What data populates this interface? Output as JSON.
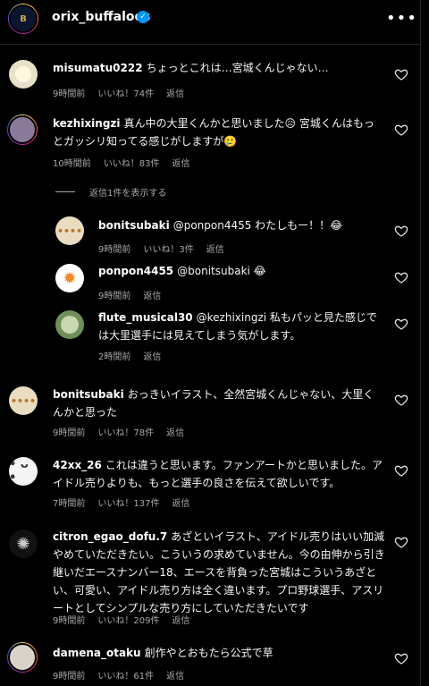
{
  "header": {
    "username": "orix_buffaloes",
    "more_label": "•••"
  },
  "labels": {
    "like": "いいね！",
    "reply": "返信",
    "show_replies": "返信1件を表示する"
  },
  "comments": [
    {
      "user": "misumatu0222",
      "text": "ちょっとこれは…宮城くんじゃない…",
      "time": "9時間前",
      "likes": "いいね！74件",
      "reply": "返信"
    },
    {
      "user": "kezhixingzi",
      "text": "真ん中の大里くんかと思いました😥 宮城くんはもっとガッシリ知ってる感じがしますが🥲",
      "time": "10時間前",
      "likes": "いいね！83件",
      "reply": "返信"
    },
    {
      "user": "bonitsubaki",
      "text": "@ponpon4455 わたしもー！！😂",
      "time": "9時間前",
      "likes": "いいね！3件",
      "reply": "返信"
    },
    {
      "user": "ponpon4455",
      "text": "@bonitsubaki 😂",
      "time": "9時間前",
      "likes": "",
      "reply": "返信"
    },
    {
      "user": "flute_musical30",
      "text": "@kezhixingzi 私もパッと見た感じでは大里選手には見えてしまう気がします。",
      "time": "2時間前",
      "likes": "",
      "reply": "返信"
    },
    {
      "user": "bonitsubaki",
      "text": "おっきいイラスト、全然宮城くんじゃない、大里くんかと思った",
      "time": "9時間前",
      "likes": "いいね！78件",
      "reply": "返信"
    },
    {
      "user": "42xx_26",
      "text": "これは違うと思います。ファンアートかと思いました。アイドル売りよりも、もっと選手の良さを伝えて欲しいです。",
      "time": "7時間前",
      "likes": "いいね！137件",
      "reply": "返信"
    },
    {
      "user": "citron_egao_dofu.7",
      "text": "あざといイラスト、アイドル売りはいい加減やめていただきたい。こういうの求めていません。今の由伸から引き継いだエースナンバー18、エースを背負った宮城はこういうあざとい、可愛い、アイドル売り方は全く違います。プロ野球選手、アスリートとしてシンプルな売り方にしていただきたいです",
      "time": "9時間前",
      "likes": "いいね！209件",
      "reply": "返信"
    },
    {
      "user": "damena_otaku",
      "text": "創作やとおもたら公式で草",
      "time": "9時間前",
      "likes": "いいね！61件",
      "reply": "返信"
    }
  ],
  "colors": {
    "background": "#000000",
    "meta": "#a8a8a8",
    "verified": "#0095f6"
  }
}
